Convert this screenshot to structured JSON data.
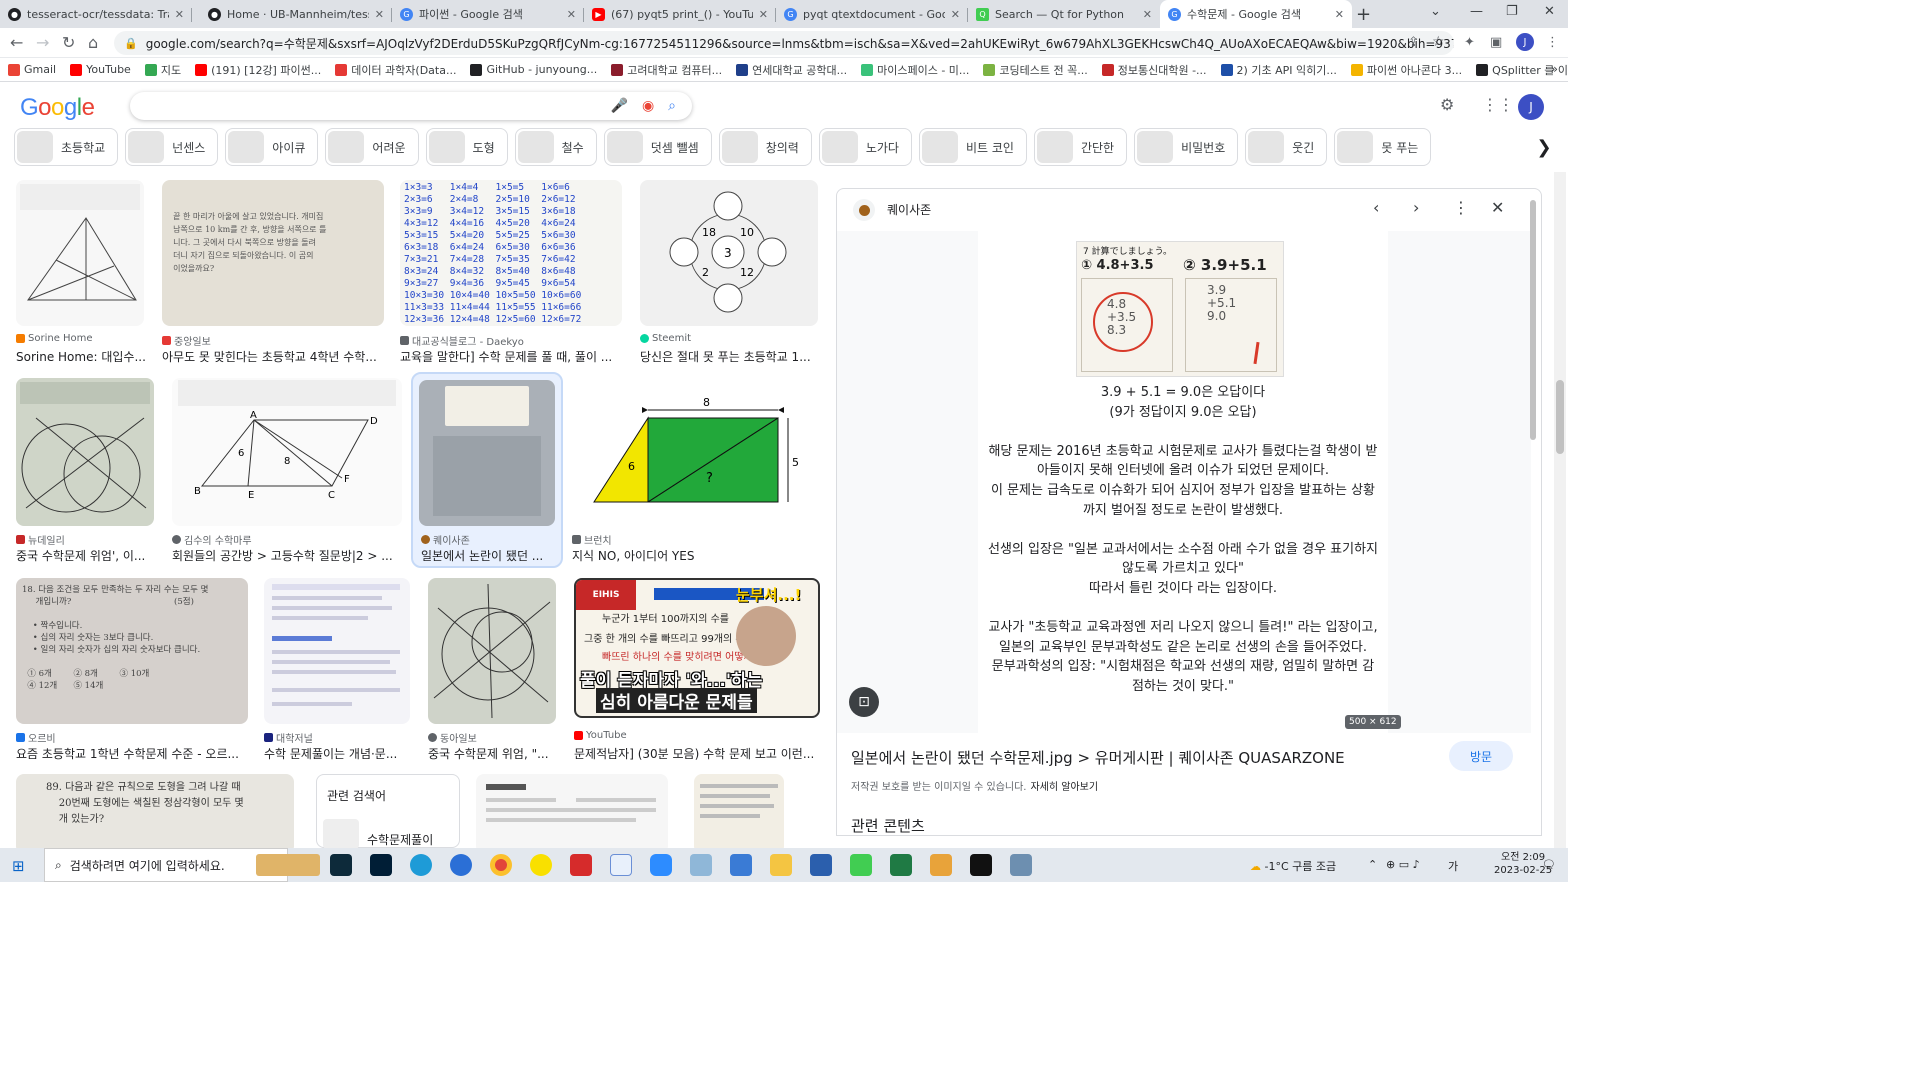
{
  "tabs": [
    {
      "title": "tesseract-ocr/tessdata: Trained",
      "color": "#202124"
    },
    {
      "title": "Home · UB-Mannheim/tesserac",
      "color": "#202124"
    },
    {
      "title": "파이썬 - Google 검색",
      "color": "#4285f4"
    },
    {
      "title": "(67) pyqt5 print_() - YouTube",
      "color": "#ff0000"
    },
    {
      "title": "pyqt qtextdocument - Google",
      "color": "#4285f4"
    },
    {
      "title": "Search — Qt for Python",
      "color": "#41cd52"
    },
    {
      "title": "수학문제 - Google 검색",
      "color": "#4285f4"
    }
  ],
  "address": {
    "url": "google.com/search?q=수학문제&sxsrf=AJOqlzVyf2DErduD5SKuPzgQRfJCyNm-cg:1677254511296&source=lnms&tbm=isch&sa=X&ved=2ahUKEwiRyt_6w679AhXL3GEKHcswCh4Q_AUoAXoECAEQAw&biw=1920&bih=937&dpr=1#imgrc=hWa..."
  },
  "bookmarks": [
    {
      "label": "Gmail",
      "color": "#ea4335"
    },
    {
      "label": "YouTube",
      "color": "#ff0000"
    },
    {
      "label": "지도",
      "color": "#34a853"
    },
    {
      "label": "(191) [12강] 파이썬...",
      "color": "#ff0000"
    },
    {
      "label": "데이터 과학자(Data...",
      "color": "#e53935"
    },
    {
      "label": "GitHub - junyoung...",
      "color": "#202124"
    },
    {
      "label": "고려대학교 컴퓨터...",
      "color": "#8b1d2c"
    },
    {
      "label": "연세대학교 공학대...",
      "color": "#1f3f8a"
    },
    {
      "label": "마이스페이스 - 미...",
      "color": "#3ac27a"
    },
    {
      "label": "코딩테스트 전 꼭...",
      "color": "#7cb342"
    },
    {
      "label": "정보통신대학원 -...",
      "color": "#c62828"
    },
    {
      "label": "2) 기초 API 익히기...",
      "color": "#1e4fa8"
    },
    {
      "label": "파이썬 아나콘다 3...",
      "color": "#f4b400"
    },
    {
      "label": "QSplitter 를 이용한...",
      "color": "#202124"
    }
  ],
  "search": {
    "placeholder": ""
  },
  "chips": [
    "초등학교",
    "넌센스",
    "아이큐",
    "어려운",
    "도형",
    "철수",
    "덧셈 뺄셈",
    "창의력",
    "노가다",
    "비트 코인",
    "간단한",
    "비밀번호",
    "웃긴",
    "못 푸는"
  ],
  "results": [
    {
      "source": "Sorine Home",
      "caption": "Sorine Home: 대입수...",
      "icolor": "#f57c00"
    },
    {
      "source": "중앙일보",
      "caption": "아무도 못 맞힌다는 초등학교 4학년 수학...",
      "icolor": "#e53935"
    },
    {
      "source": "대교공식블로그 - Daekyo",
      "caption": "교육을 말한다] 수학 문제를 풀 때, 풀이 ...",
      "icolor": "#5f6368"
    },
    {
      "source": "Steemit",
      "caption": "당신은 절대 못 푸는 초등학교 1...",
      "icolor": "#06d6a0"
    },
    {
      "source": "뉴데일리",
      "caption": "중국 수학문제 위엄', 이...",
      "icolor": "#c62828"
    },
    {
      "source": "김수의 수학마루",
      "caption": "회원들의 공간방 > 고등수학 질문방|2 > ...",
      "icolor": "#5f6368"
    },
    {
      "source": "퀘이사존",
      "caption": "일본에서 논란이 됐던 ...",
      "icolor": "#a0621c"
    },
    {
      "source": "브런치",
      "caption": "지식 NO, 아이디어 YES",
      "icolor": "#5f6368"
    },
    {
      "source": "오르비",
      "caption": "요즘 초등학교 1학년 수학문제 수준 - 오르...",
      "icolor": "#1a73e8"
    },
    {
      "source": "대학저널",
      "caption": "수학 문제풀이는 개념·문...",
      "icolor": "#1a237e"
    },
    {
      "source": "동아일보",
      "caption": "중국 수학문제 위엄, \"...",
      "icolor": "#5f6368"
    },
    {
      "source": "YouTube",
      "caption": "문제적남자] (30분 모음) 수학 문제 보고 이런...",
      "icolor": "#ff0000"
    }
  ],
  "result_images": {
    "r2_text": "  끝 한 마리가 아울에 살고 있었습니다. 개미집\n  남쪽으로 10 km를 간 후, 방향을 서쪽으로 틀\n  니다. 그 곳에서 다시 북쪽으로 방향을 돌려\n  더니 자기 집으로 되돌아왔습니다. 이 곰의\n  이었을까요?",
    "r3_text": "1×3=3   1×4=4   1×5=5   1×6=6\n2×3=6   2×4=8   2×5=10  2×6=12\n3×3=9   3×4=12  3×5=15  3×6=18\n4×3=12  4×4=16  4×5=20  4×6=24\n5×3=15  5×4=20  5×5=25  5×6=30\n6×3=18  6×4=24  6×5=30  6×6=36\n7×3=21  7×4=28  7×5=35  7×6=42\n8×3=24  8×4=32  8×5=40  8×6=48\n9×3=27  9×4=36  9×5=45  9×6=54\n10×3=30 10×4=40 10×5=50 10×6=60\n11×3=33 11×4=44 11×5=55 11×6=66\n12×3=36 12×4=48 12×5=60 12×6=72",
    "r4_nums": [
      "18",
      "10",
      "3",
      "2",
      "12"
    ],
    "r6_labels": [
      "A",
      "D",
      "B",
      "E",
      "C",
      "F",
      "6",
      "8"
    ],
    "r8_labels": [
      "8",
      "6",
      "?",
      "5"
    ],
    "r9_text": "18. 다음 조건을 모두 만족하는 두 자리 수는 모두 몇\n     개입니까?                                      (5점)\n\n    • 짝수입니다.\n    • 십의 자리 숫자는 3보다 큽니다.\n    • 일의 자리 숫자가 십의 자리 숫자보다 큽니다.\n\n  ① 6개        ② 8개        ③ 10개\n  ④ 12개      ⑤ 14개",
    "r12_text": [
      "누군가 1부터 100까지의 수를",
      "그중 한 개의 수를 빠뜨리고 99개의 수만",
      "빠뜨린 하나의 수를 맞히려면 어떻게?",
      "풀이 듣자마자 '와...'하는",
      "심히 아름다운 문제들"
    ],
    "r12_badge": "눈부셔...!",
    "r13_text": "89. 다음과 같은 규칙으로 도형을 그려 나갈 때\n    20번째 도형에는 색칠된 정삼각형이 모두 몇\n    개 있는가?"
  },
  "related": {
    "title": "관련 검색어",
    "query": "수학문제풀이"
  },
  "panel": {
    "site": "퀘이사존",
    "ex_labels": [
      "7  計算でしましょう。",
      "① 4.8+3.5",
      "② 3.9+5.1"
    ],
    "lines": [
      "3.9 + 5.1 = 9.0은 오답이다",
      "(9가 정답이지 9.0은 오답)",
      "",
      "해당 문제는 2016년 초등학교 시험문제로 교사가 틀렸다는걸 학생이 받",
      "아들이지 못해 인터넷에 올려 이슈가 되었던 문제이다.",
      "이 문제는 급속도로 이슈화가 되어 심지어 정부가 입장을 발표하는 상황",
      "까지 벌어질 정도로 논란이 발생했다.",
      "",
      "선생의 입장은 \"일본 교과서에서는 소수점 아래 수가 없을 경우 표기하지",
      "않도록 가르치고 있다\"",
      "따라서 틀린 것이다 라는 입장이다.",
      "",
      "교사가 \"초등학교 교육과정엔 저리 나오지 않으니 틀려!\" 라는 입장이고,",
      "일본의 교육부인 문부과학성도 같은 논리로 선생의 손을 들어주었다.",
      "문부과학성의 입장: \"시험채점은 학교와 선생의 재량, 엄밀히 말하면 감",
      "점하는 것이 맞다.\""
    ],
    "dims": "500 × 612",
    "title": "일본에서 논란이 됐던 수학문제.jpg > 유머게시판 | 퀘이사존 QUASARZONE",
    "visit": "방문",
    "copyright": "저작권 보호를 받는 이미지일 수 있습니다.",
    "learn_more": "자세히 알아보기",
    "related_content": "관련 콘텐츠"
  },
  "taskbar": {
    "search_placeholder": "검색하려면 여기에 입력하세요.",
    "weather": "-1°C  구름 조금",
    "ime": "가",
    "time": "오전 2:09",
    "date": "2023-02-25"
  }
}
